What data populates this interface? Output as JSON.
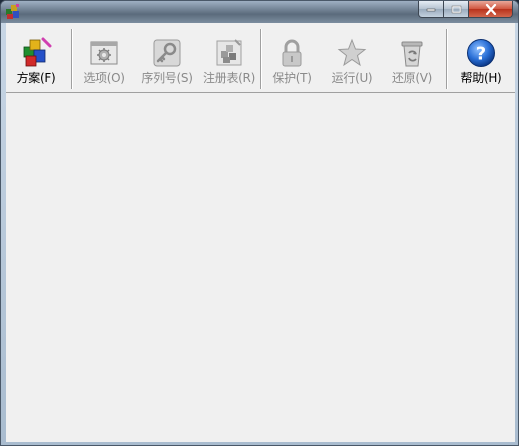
{
  "window": {
    "title": ""
  },
  "caption_buttons": {
    "minimize": "minimize-icon",
    "maximize": "maximize-icon",
    "close": "close-icon"
  },
  "toolbar": {
    "items": [
      {
        "id": "scheme",
        "label": "方案(F)",
        "icon": "scheme-cubes-icon",
        "enabled": true
      },
      {
        "id": "options",
        "label": "选项(O)",
        "icon": "options-window-gear-icon",
        "enabled": false
      },
      {
        "id": "serial",
        "label": "序列号(S)",
        "icon": "key-icon",
        "enabled": false
      },
      {
        "id": "registry",
        "label": "注册表(R)",
        "icon": "registry-cubes-icon",
        "enabled": false
      },
      {
        "id": "protect",
        "label": "保护(T)",
        "icon": "padlock-icon",
        "enabled": false
      },
      {
        "id": "run",
        "label": "运行(U)",
        "icon": "star-icon",
        "enabled": false
      },
      {
        "id": "restore",
        "label": "还原(V)",
        "icon": "recycle-bin-icon",
        "enabled": false
      },
      {
        "id": "help",
        "label": "帮助(H)",
        "icon": "help-question-icon",
        "enabled": true
      }
    ]
  },
  "colors": {
    "disabled_text": "#8a8a8a",
    "help_blue": "#2a6fd6",
    "close_red": "#c9432a"
  }
}
